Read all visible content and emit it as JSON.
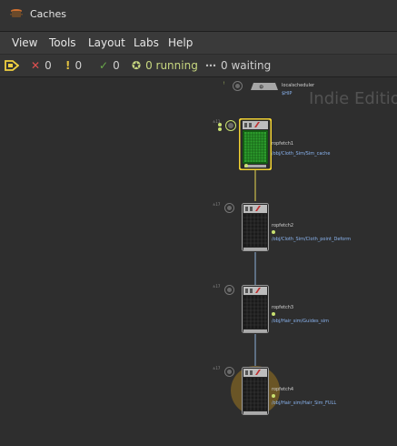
{
  "window": {
    "title": "Caches",
    "icon": "cache-pot-icon"
  },
  "menu": [
    "View",
    "Tools",
    "Layout",
    "Labs",
    "Help"
  ],
  "status": {
    "cook_icon": "cook-arrow-icon",
    "failed": {
      "icon": "x-icon",
      "count": "0",
      "color": "#e05050"
    },
    "warnings": {
      "icon": "exclamation-icon",
      "count": "0",
      "color": "#e0c040"
    },
    "succeeded": {
      "icon": "check-icon",
      "count": "0",
      "color": "#6aaa4a"
    },
    "running": {
      "icon": "running-icon",
      "text": "0 running",
      "color": "#c8d880"
    },
    "waiting": {
      "icon": "dots-icon",
      "text": "0 waiting",
      "color": "#bbbbbb"
    }
  },
  "graph": {
    "watermark": "Indie Edition",
    "scheduler": {
      "name": "localscheduler",
      "path": "$HIP"
    },
    "nodes": [
      {
        "name": "ropfetch1",
        "path": "/obj/Cloth_Sim/Sim_cache",
        "selected": true
      },
      {
        "name": "ropfetch2",
        "path": "/obj/Cloth_Sim/Cloth_point_Deform"
      },
      {
        "name": "ropfetch3",
        "path": "/obj/Hair_sim/Guides_sim"
      },
      {
        "name": "ropfetch4",
        "path": "/obj/Hair_sim/Hair_Sim_FULL"
      }
    ]
  },
  "colors": {
    "selected": "#f2d233",
    "wire": "#8fb0d8",
    "work_items": "#1a7a1a"
  }
}
